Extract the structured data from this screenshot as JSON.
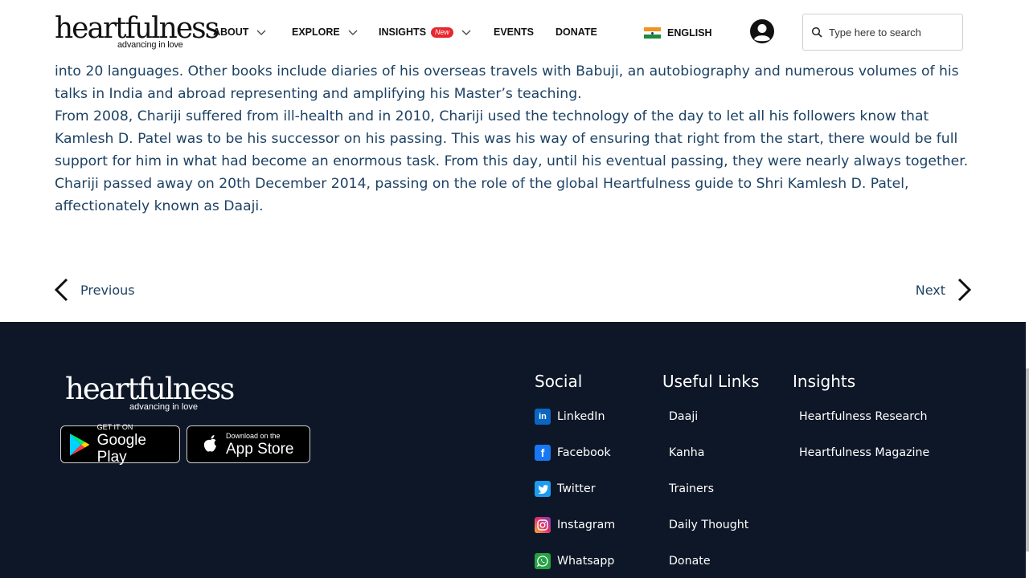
{
  "header": {
    "logo_word": "heartfulness",
    "logo_tag": "advancing in love",
    "nav": [
      {
        "label": "ABOUT"
      },
      {
        "label": "EXPLORE"
      },
      {
        "label": "INSIGHTS",
        "badge": "New"
      },
      {
        "label": "EVENTS"
      },
      {
        "label": "DONATE"
      }
    ],
    "language": "ENGLISH",
    "search_placeholder": "Type here to search"
  },
  "article": {
    "paragraphs": [
      "into 20 languages. Other books include diaries of his overseas travels with Babuji, an autobiography and numerous volumes of his talks in India and abroad representing and amplifying his Master’s teaching.",
      "From 2008, Chariji suffered from ill-health and in 2010, Chariji used the technology of the day to let all his followers know that Kamlesh D. Patel was to be his successor on his passing. This was his way of ensuring that right from the start, there would be full support for him in what had become an enormous task. From this day, until his eventual passing, they were nearly always together.",
      "Chariji passed away on 20th December 2014, passing on the role of the global Heartfulness guide to Shri Kamlesh D. Patel, affectionately known as Daaji."
    ],
    "prev_label": "Previous",
    "next_label": "Next"
  },
  "footer": {
    "logo_word": "heartfulness",
    "logo_tag": "advancing in love",
    "google_play": {
      "small": "GET IT ON",
      "big": "Google Play"
    },
    "app_store": {
      "small": "Download on the",
      "big": "App Store"
    },
    "social": {
      "title": "Social",
      "links": [
        {
          "label": "LinkedIn",
          "icon": "linkedin-icon",
          "color": "#0a66c2"
        },
        {
          "label": "Facebook",
          "icon": "facebook-icon",
          "color": "#1877f2"
        },
        {
          "label": "Twitter",
          "icon": "twitter-icon",
          "color": "#1d9bf0"
        },
        {
          "label": "Instagram",
          "icon": "instagram-icon",
          "color": "#e1306c"
        },
        {
          "label": "Whatsapp",
          "icon": "whatsapp-icon",
          "color": "#25a244"
        }
      ]
    },
    "useful_links": {
      "title": "Useful Links",
      "links": [
        "Daaji",
        "Kanha",
        "Trainers",
        "Daily Thought",
        "Donate"
      ]
    },
    "insights": {
      "title": "Insights",
      "links": [
        "Heartfulness Research",
        "Heartfulness Magazine"
      ]
    }
  },
  "colors": {
    "text": "#1d4264",
    "footer_bg": "#0e1727",
    "badge": "#e8262e"
  }
}
